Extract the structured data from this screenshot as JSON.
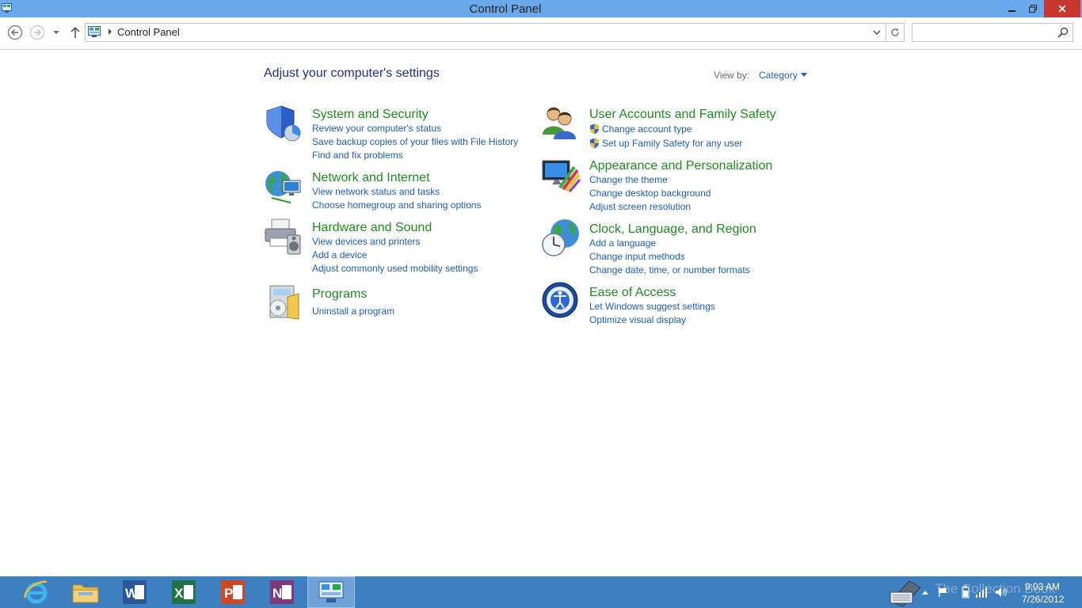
{
  "window": {
    "title": "Control Panel"
  },
  "nav": {
    "breadcrumb": "Control Panel",
    "search_value": ""
  },
  "content": {
    "heading": "Adjust your computer's settings",
    "view_by_label": "View by:",
    "view_by_value": "Category"
  },
  "categories": [
    {
      "title": "System and Security",
      "icon": "shield-icon",
      "links": [
        "Review your computer's status",
        "Save backup copies of your files with File History",
        "Find and fix problems"
      ]
    },
    {
      "title": "Network and Internet",
      "icon": "globe-network-icon",
      "links": [
        "View network status and tasks",
        "Choose homegroup and sharing options"
      ]
    },
    {
      "title": "Hardware and Sound",
      "icon": "printer-speaker-icon",
      "links": [
        "View devices and printers",
        "Add a device",
        "Adjust commonly used mobility settings"
      ]
    },
    {
      "title": "Programs",
      "icon": "programs-icon",
      "links": [
        "Uninstall a program"
      ]
    },
    {
      "title": "User Accounts and Family Safety",
      "icon": "users-icon",
      "links": [
        "Change account type",
        "Set up Family Safety for any user"
      ]
    },
    {
      "title": "Appearance and Personalization",
      "icon": "monitor-palette-icon",
      "links": [
        "Change the theme",
        "Change desktop background",
        "Adjust screen resolution"
      ]
    },
    {
      "title": "Clock, Language, and Region",
      "icon": "clock-globe-icon",
      "links": [
        "Add a language",
        "Change input methods",
        "Change date, time, or number formats"
      ]
    },
    {
      "title": "Ease of Access",
      "icon": "ease-of-access-icon",
      "links": [
        "Let Windows suggest settings",
        "Optimize visual display"
      ]
    }
  ],
  "taskbar": {
    "apps": [
      {
        "name": "Internet Explorer",
        "icon": "ie-icon"
      },
      {
        "name": "File Explorer",
        "icon": "folder-icon"
      },
      {
        "name": "Word",
        "icon": "word-icon",
        "letter": "W"
      },
      {
        "name": "Excel",
        "icon": "excel-icon",
        "letter": "X"
      },
      {
        "name": "PowerPoint",
        "icon": "powerpoint-icon",
        "letter": "P"
      },
      {
        "name": "OneNote",
        "icon": "onenote-icon",
        "letter": "N"
      },
      {
        "name": "Control Panel",
        "icon": "control-panel-icon"
      }
    ],
    "clock_time": "9:03 AM",
    "clock_date": "7/26/2012",
    "watermark": "The Collection Book"
  },
  "colors": {
    "titlebar": "#6aa9ec",
    "taskbar": "#3e7fbf",
    "category_title": "#1e8c1e",
    "link": "#1e5ebf",
    "heading": "#1e3287",
    "close_button": "#c7372f"
  }
}
